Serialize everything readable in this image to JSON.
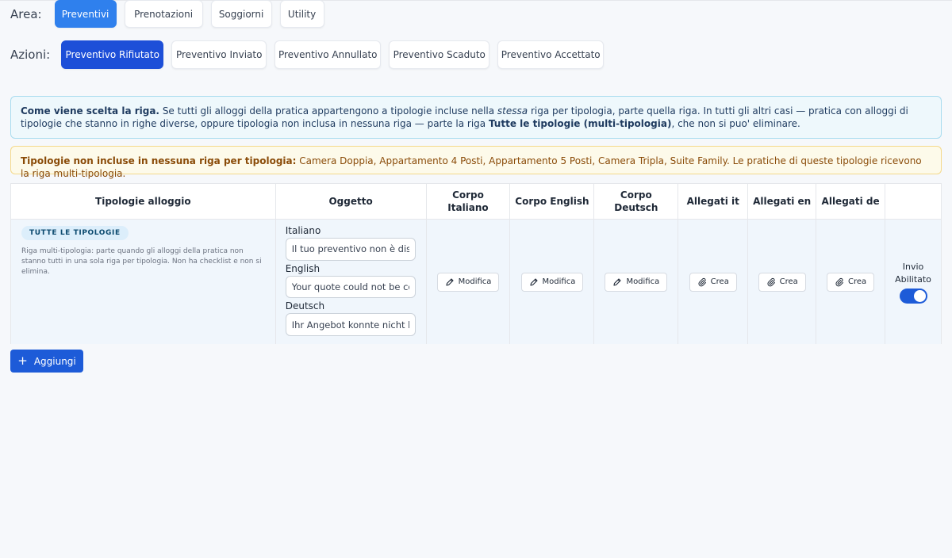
{
  "area": {
    "label": "Area:",
    "tabs": [
      {
        "label": "Preventivi",
        "active": true
      },
      {
        "label": "Prenotazioni",
        "active": false
      },
      {
        "label": "Soggiorni",
        "active": false
      },
      {
        "label": "Utility",
        "active": false
      }
    ]
  },
  "azioni": {
    "label": "Azioni:",
    "tabs": [
      {
        "label": "Preventivo Rifiutato",
        "active": true
      },
      {
        "label": "Preventivo Inviato",
        "active": false
      },
      {
        "label": "Preventivo Annullato",
        "active": false
      },
      {
        "label": "Preventivo Scaduto",
        "active": false
      },
      {
        "label": "Preventivo Accettato",
        "active": false
      }
    ]
  },
  "info_banner": {
    "title": "Come viene scelta la riga.",
    "text_1": " Se tutti gli alloggi della pratica appartengono a tipologie incluse nella ",
    "italic": "stessa",
    "text_2": " riga per tipologia, parte quella riga. In tutti gli altri casi — pratica con alloggi di tipologie che stanno in righe diverse, oppure tipologia non inclusa in nessuna riga — parte la riga ",
    "bold": "Tutte le tipologie (multi-tipologia)",
    "text_3": ", che non si puo' eliminare."
  },
  "warning_banner": {
    "title": "Tipologie non incluse in nessuna riga per tipologia:",
    "text": " Camera Doppia, Appartamento 4 Posti, Appartamento 5 Posti, Camera Tripla, Suite Family. Le pratiche di queste tipologie ricevono la riga multi-tipologia."
  },
  "table": {
    "headers": {
      "tipologie": "Tipologie alloggio",
      "oggetto": "Oggetto",
      "corpo_it": "Corpo Italiano",
      "corpo_en": "Corpo English",
      "corpo_de": "Corpo Deutsch",
      "allegati_it": "Allegati it",
      "allegati_en": "Allegati en",
      "allegati_de": "Allegati de"
    },
    "row": {
      "badge": "TUTTE LE TIPOLOGIE",
      "description": "Riga multi-tipologia: parte quando gli alloggi della pratica non stanno tutti in una sola riga per tipologia. Non ha checklist e non si elimina.",
      "oggetto": {
        "it_label": "Italiano",
        "it_value": "Il tuo preventivo non è disponibile",
        "en_label": "English",
        "en_value": "Your quote could not be confirmed",
        "de_label": "Deutsch",
        "de_value": "Ihr Angebot konnte nicht bestätigt werden"
      },
      "modifica_label": "Modifica",
      "crea_label": "Crea",
      "invio_label": "Invio Abilitato",
      "invio_enabled": true
    }
  },
  "add_button": {
    "label": "Aggiungi"
  },
  "colors": {
    "primary": "#1d5bd8",
    "area_active": "#2f80ed",
    "info_bg": "#eef8fc",
    "warn_bg": "#fdfaea"
  }
}
